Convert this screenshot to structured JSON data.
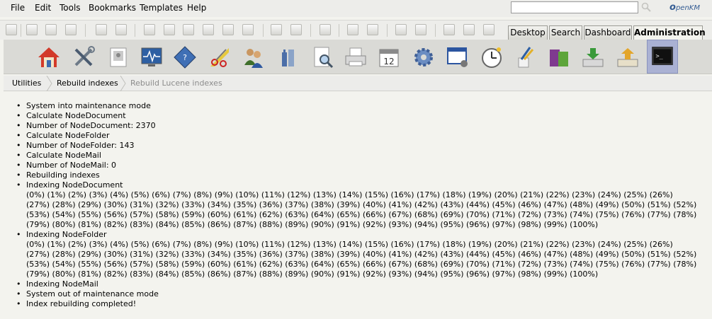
{
  "menubar": {
    "items": [
      "File",
      "Edit",
      "Tools",
      "Bookmarks",
      "Templates",
      "Help"
    ],
    "search_placeholder": ""
  },
  "logo": {
    "main": "penKM",
    "prefix": "o"
  },
  "tabs": [
    "Desktop",
    "Search",
    "Dashboard",
    "Administration"
  ],
  "active_tab": "Administration",
  "admin_icons": [
    "home-icon",
    "tools-icon",
    "image-icon",
    "monitor-icon",
    "diamond-icon",
    "scissors-icon",
    "users-icon",
    "bottles-icon",
    "magnify-doc-icon",
    "printer-icon",
    "calendar-icon",
    "gear-icon",
    "window-icon",
    "clock-icon",
    "brush-icon",
    "book-icon",
    "download-icon",
    "upload-icon",
    "terminal-icon"
  ],
  "calendar_day": "12",
  "breadcrumb": {
    "utilities": "Utilities",
    "rebuild_indexes": "Rebuild indexes",
    "rebuild_lucene": "Rebuild Lucene indexes"
  },
  "log": {
    "l1": "System into maintenance mode",
    "l2": "Calculate NodeDocument",
    "l3": "Number of NodeDocument: 2370",
    "l4": "Calculate NodeFolder",
    "l5": "Number of NodeFolder: 143",
    "l6": "Calculate NodeMail",
    "l7": "Number of NodeMail: 0",
    "l8": "Rebuilding indexes",
    "l9": "Indexing NodeDocument",
    "p1a": "(0%) (1%) (2%) (3%) (4%) (5%) (6%) (7%) (8%) (9%) (10%) (11%) (12%) (13%) (14%) (15%) (16%) (17%) (18%) (19%) (20%) (21%) (22%) (23%) (24%) (25%) (26%)",
    "p1b": "(27%) (28%) (29%) (30%) (31%) (32%) (33%) (34%) (35%) (36%) (37%) (38%) (39%) (40%) (41%) (42%) (43%) (44%) (45%) (46%) (47%) (48%) (49%) (50%) (51%) (52%)",
    "p1c": "(53%) (54%) (55%) (56%) (57%) (58%) (59%) (60%) (61%) (62%) (63%) (64%) (65%) (66%) (67%) (68%) (69%) (70%) (71%) (72%) (73%) (74%) (75%) (76%) (77%) (78%)",
    "p1d": "(79%) (80%) (81%) (82%) (83%) (84%) (85%) (86%) (87%) (88%) (89%) (90%) (91%) (92%) (93%) (94%) (95%) (96%) (97%) (98%) (99%) (100%)",
    "l10": "Indexing NodeFolder",
    "p2a": "(0%) (1%) (2%) (3%) (4%) (5%) (6%) (7%) (8%) (9%) (10%) (11%) (12%) (13%) (14%) (15%) (16%) (17%) (18%) (19%) (20%) (21%) (22%) (23%) (24%) (25%) (26%)",
    "p2b": "(27%) (28%) (29%) (30%) (31%) (32%) (33%) (34%) (35%) (36%) (37%) (38%) (39%) (40%) (41%) (42%) (43%) (44%) (45%) (46%) (47%) (48%) (49%) (50%) (51%) (52%)",
    "p2c": "(53%) (54%) (55%) (56%) (57%) (58%) (59%) (60%) (61%) (62%) (63%) (64%) (65%) (66%) (67%) (68%) (69%) (70%) (71%) (72%) (73%) (74%) (75%) (76%) (77%) (78%)",
    "p2d": "(79%) (80%) (81%) (82%) (83%) (84%) (85%) (86%) (87%) (88%) (89%) (90%) (91%) (92%) (93%) (94%) (95%) (96%) (97%) (98%) (99%) (100%)",
    "l11": "Indexing NodeMail",
    "l12": "System out of maintenance mode",
    "l13": "Index rebuilding completed!"
  },
  "colors": {
    "active_icon_bg": "#aab1d3",
    "logo": "#355d94",
    "panel_bg": "#f3f3ee"
  }
}
